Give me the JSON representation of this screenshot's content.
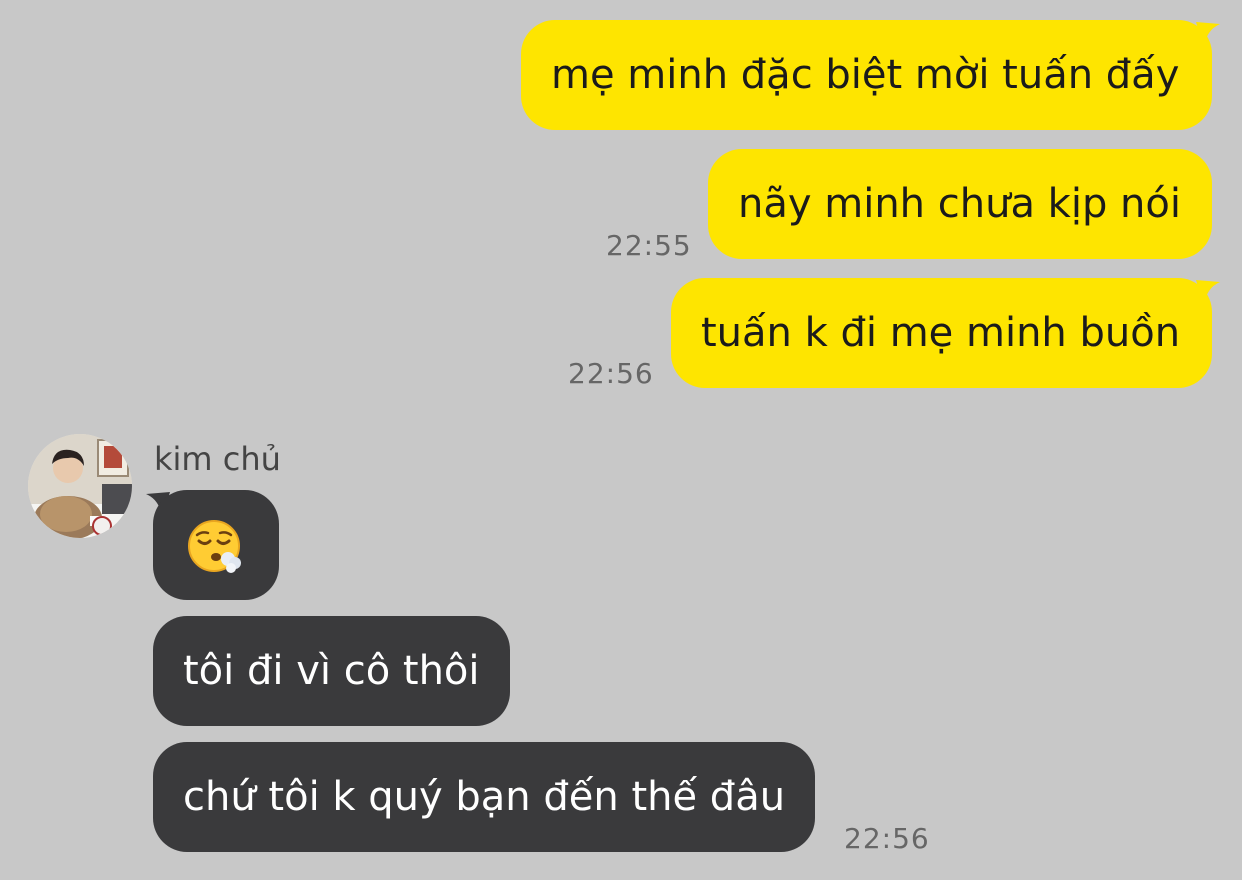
{
  "messages_out": [
    {
      "text": "mẹ minh đặc biệt mời tuấn đấy",
      "time": ""
    },
    {
      "text": "nãy minh chưa kịp nói",
      "time": "22:55"
    },
    {
      "text": "tuấn k đi mẹ minh buồn",
      "time": "22:56"
    }
  ],
  "incoming": {
    "sender": "kim chủ",
    "emoji": "face-exhaling-emoji",
    "messages": [
      {
        "text": "tôi đi vì cô thôi"
      },
      {
        "text": "chứ tôi k quý bạn đến thế đâu"
      }
    ],
    "time": "22:56"
  },
  "colors": {
    "background": "#c8c8c8",
    "outgoing_bubble": "#fee500",
    "incoming_bubble": "#3a3a3c"
  }
}
